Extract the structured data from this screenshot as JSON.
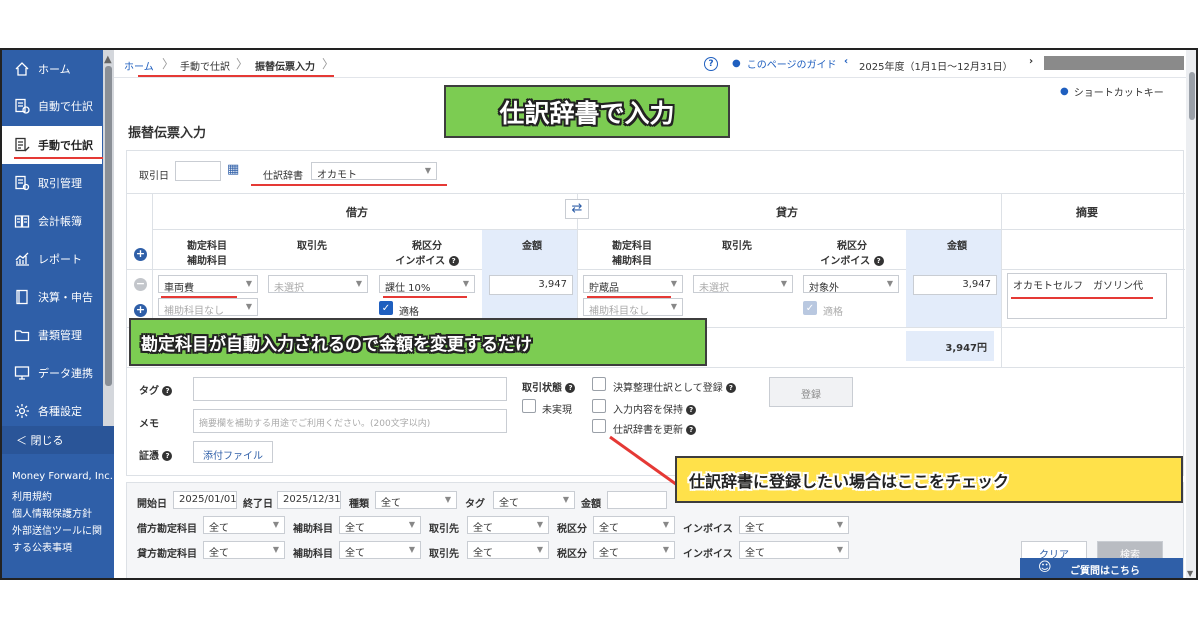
{
  "sidebar": {
    "items": [
      {
        "label": "ホーム",
        "icon": "home-icon"
      },
      {
        "label": "自動で仕訳",
        "icon": "auto-journal-icon"
      },
      {
        "label": "手動で仕訳",
        "icon": "manual-journal-icon"
      },
      {
        "label": "取引管理",
        "icon": "transaction-icon"
      },
      {
        "label": "会計帳簿",
        "icon": "ledger-icon"
      },
      {
        "label": "レポート",
        "icon": "report-icon"
      },
      {
        "label": "決算・申告",
        "icon": "tax-filing-icon"
      },
      {
        "label": "書類管理",
        "icon": "folder-icon"
      },
      {
        "label": "データ連携",
        "icon": "data-link-icon"
      },
      {
        "label": "各種設定",
        "icon": "gear-icon"
      }
    ],
    "collapse_label": "＜ 閉じる",
    "company": "Money Forward, Inc.",
    "links": [
      "利用規約",
      "個人情報保護方針",
      "外部送信ツールに関",
      "する公表事項"
    ]
  },
  "topbar": {
    "breadcrumb": [
      "ホーム",
      "手動で仕訳",
      "振替伝票入力"
    ],
    "guide_label": "このページのガイド",
    "fiscal_year": "2025年度（1月1日〜12月31日）",
    "shortcut_label": "ショートカットキー"
  },
  "page": {
    "title": "振替伝票入力"
  },
  "form": {
    "date_label": "取引日",
    "dictionary_label": "仕訳辞書",
    "dictionary_value": "オカモト",
    "debit_header": "借方",
    "credit_header": "貸方",
    "summary_header": "摘要",
    "col_account": "勘定科目",
    "col_sub_account": "補助科目",
    "col_partner": "取引先",
    "col_tax": "税区分",
    "col_invoice": "インボイス",
    "col_amount": "金額",
    "debit": {
      "account": "車両費",
      "sub_account": "補助科目なし",
      "partner": "未選択",
      "tax": "課仕 10%",
      "invoice_label": "適格",
      "amount": "3,947"
    },
    "credit": {
      "account": "貯蔵品",
      "sub_account": "補助科目なし",
      "partner": "未選択",
      "tax": "対象外",
      "invoice_label": "適格",
      "amount": "3,947"
    },
    "summary_value": "オカモトセルフ　ガソリン代",
    "total_credit": "3,947円",
    "tag_label": "タグ",
    "memo_label": "メモ",
    "memo_placeholder": "摘要欄を補助する用途でご利用ください。(200文字以内)",
    "evidence_label": "証憑",
    "attach_label": "添付ファイル",
    "status_label": "取引状態",
    "unrealized_label": "未実現",
    "closing_label": "決算整理仕訳として登録",
    "keep_label": "入力内容を保持",
    "update_dict_label": "仕訳辞書を更新",
    "register_label": "登録"
  },
  "search": {
    "start_label": "開始日",
    "start_value": "2025/01/01",
    "end_label": "終了日",
    "end_value": "2025/12/31",
    "kind_label": "種類",
    "tag_label": "タグ",
    "amount_label": "金額",
    "all": "全て",
    "debit_account_label": "借方勘定科目",
    "credit_account_label": "貸方勘定科目",
    "sub_label": "補助科目",
    "partner_label": "取引先",
    "tax_label": "税区分",
    "invoice_label": "インボイス",
    "clear_label": "クリア",
    "search_label": "検索"
  },
  "overlays": {
    "title": "仕訳辞書で入力",
    "middle": "勘定科目が自動入力されるので金額を変更するだけ",
    "bottom": "仕訳辞書に登録したい場合はここをチェック"
  },
  "question_label": "ご質問はこちら",
  "colors": {
    "sidebar": "#2f5fa8",
    "accent_red": "#e53935",
    "overlay_green": "#7ccc52",
    "overlay_yellow": "#ffe14a"
  }
}
